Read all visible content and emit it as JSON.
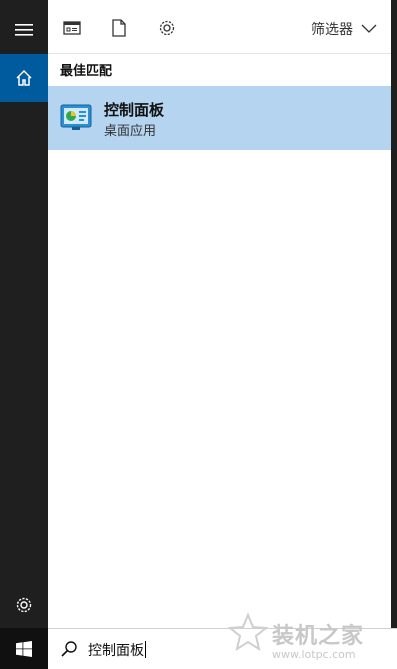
{
  "toolbar": {
    "icons": [
      "apps-icon",
      "document-icon",
      "settings-icon"
    ],
    "filter_label": "筛选器"
  },
  "best_match": {
    "section_label": "最佳匹配",
    "result_title": "控制面板",
    "result_subtitle": "桌面应用"
  },
  "search": {
    "query": "控制面板"
  },
  "watermark": {
    "title": "装机之家",
    "url": "www.lotpc.com"
  },
  "colors": {
    "accent": "#005a9e",
    "selected_row": "#b4d4f0",
    "rail": "#1f1f1f"
  }
}
